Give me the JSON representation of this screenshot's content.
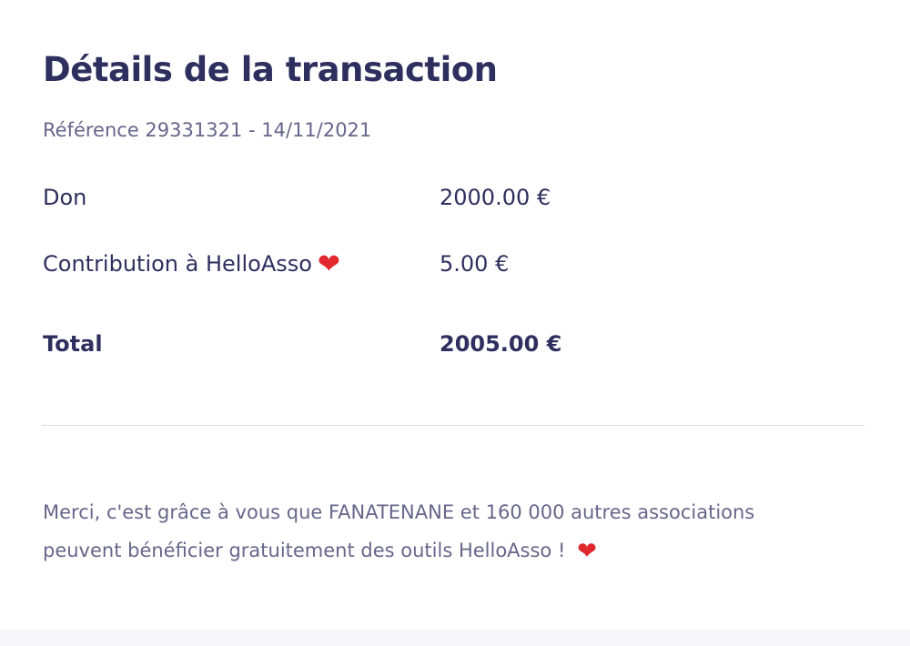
{
  "transaction": {
    "title": "Détails de la transaction",
    "reference": "Référence 29331321 - 14/11/2021",
    "lines": [
      {
        "label": "Don",
        "amount": "2000.00 €"
      },
      {
        "label": "Contribution à HelloAsso",
        "amount": "5.00 €"
      }
    ],
    "total": {
      "label": "Total",
      "amount": "2005.00 €"
    }
  },
  "thanks": {
    "line1": "Merci, c'est grâce à vous que FANATENANE et 160 000 autres associations",
    "line2": "peuvent bénéficier gratuitement des outils HelloAsso !"
  },
  "icons": {
    "heart": "heart-icon",
    "heart_color": "#e0282e"
  }
}
